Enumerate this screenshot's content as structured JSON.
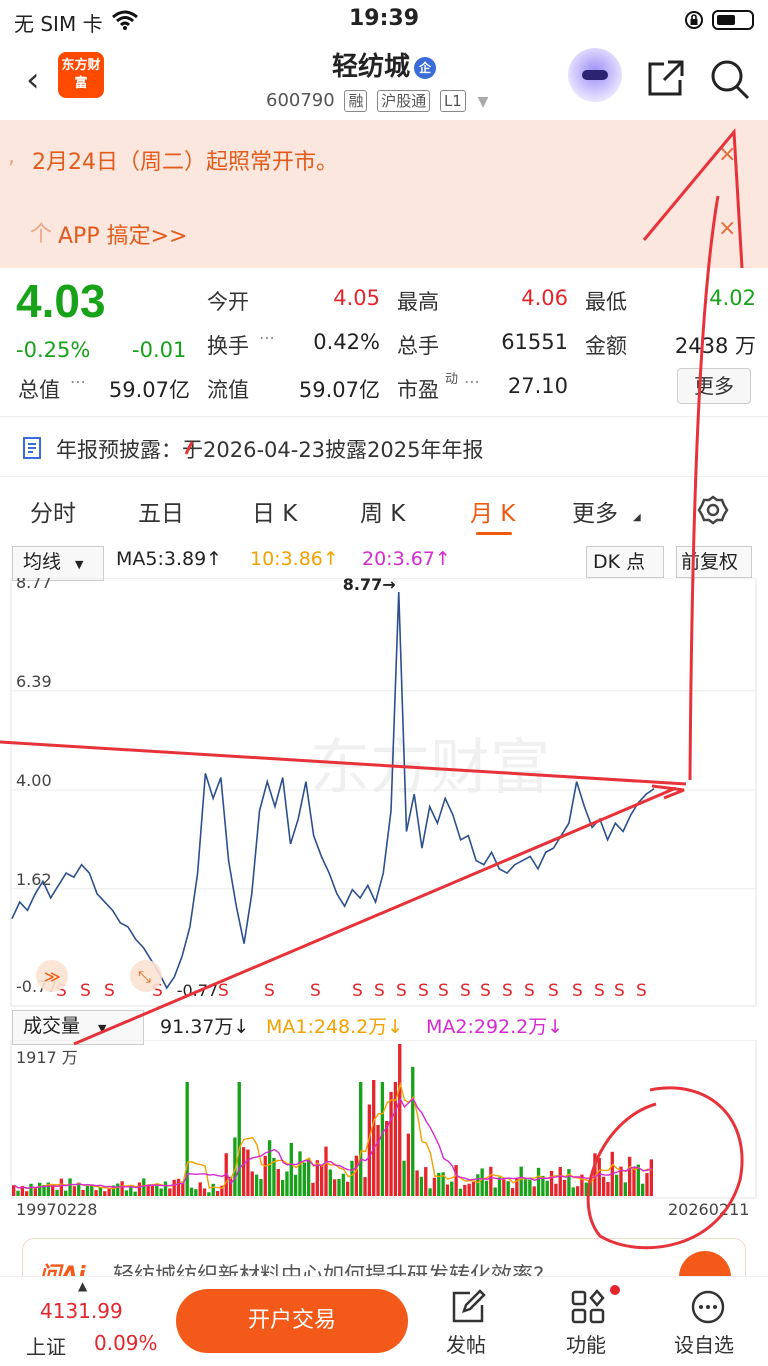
{
  "status_bar": {
    "carrier": "无 SIM 卡",
    "time": "19:39"
  },
  "header": {
    "logo_text": "东方财富",
    "name": "轻纺城",
    "name_badge": "企",
    "code": "600790",
    "tags": [
      "融",
      "沪股通",
      "L1"
    ]
  },
  "notice": {
    "line1": "2月24日（周二）起照常开市。",
    "line2": "APP 搞定>>",
    "close": "×"
  },
  "quote": {
    "price": "4.03",
    "change_pct": "-0.25%",
    "change": "-0.01",
    "fields": [
      {
        "label": "今开",
        "value": "4.05"
      },
      {
        "label": "最高",
        "value": "4.06"
      },
      {
        "label": "最低",
        "value": "4.02"
      },
      {
        "label": "换手",
        "value": "0.42%"
      },
      {
        "label": "总手",
        "value": "61551"
      },
      {
        "label": "金额",
        "value": "2438 万"
      },
      {
        "label": "总值",
        "value": "59.07亿"
      },
      {
        "label": "流值",
        "value": "59.07亿"
      },
      {
        "label": "市盈",
        "value": "27.10"
      }
    ],
    "more_btn": "更多"
  },
  "report": {
    "text": "年报预披露：于2026-04-23披露2025年年报"
  },
  "tabs": [
    {
      "label": "分时"
    },
    {
      "label": "五日"
    },
    {
      "label": "日 K"
    },
    {
      "label": "周 K"
    },
    {
      "label": "月 K"
    },
    {
      "label": "更多"
    }
  ],
  "chart_toolbar": {
    "ma_select": "均线",
    "ma5": "MA5:3.89↑",
    "ma10": "10:3.86↑",
    "ma20": "20:3.67↑",
    "dk_btn": "DK 点",
    "fq_btn": "前复权"
  },
  "chart_data": {
    "type": "line",
    "price_ticks": [
      "8.77",
      "6.39",
      "4.00",
      "1.62",
      "-0.77"
    ],
    "high_marker": "8.77→",
    "low_marker": "-0.77",
    "series": [
      {
        "values": [
          0.9,
          1.3,
          1.1,
          1.5,
          1.8,
          1.4,
          1.7,
          2.0,
          1.9,
          2.2,
          2.0,
          1.5,
          1.3,
          1.1,
          0.8,
          0.7,
          0.4,
          0.2,
          -0.1,
          -0.4,
          -0.77,
          -0.5,
          0.0,
          0.7,
          2.0,
          4.4,
          3.8,
          4.3,
          2.3,
          1.2,
          0.3,
          1.5,
          3.5,
          4.2,
          3.6,
          4.3,
          2.7,
          3.3,
          4.2,
          2.9,
          2.4,
          2.0,
          1.5,
          1.2,
          1.6,
          1.4,
          1.7,
          1.3,
          2.0,
          3.5,
          8.77,
          3.0,
          3.9,
          2.6,
          3.6,
          3.2,
          3.8,
          3.4,
          2.8,
          2.9,
          2.3,
          2.2,
          2.5,
          2.1,
          2.0,
          2.2,
          2.3,
          2.4,
          2.1,
          2.5,
          2.6,
          2.9,
          3.2,
          4.2,
          3.6,
          3.1,
          3.3,
          2.8,
          3.2,
          3.0,
          3.4,
          3.7,
          3.9,
          4.03
        ]
      }
    ],
    "signals": [
      "S",
      "S",
      "S",
      "S",
      "S",
      "S",
      "S",
      "S",
      "S",
      "S",
      "S",
      "S",
      "S",
      "S",
      "S",
      "S",
      "S",
      "S",
      "S",
      "S",
      "S",
      "S",
      "S"
    ],
    "volume_label": "成交量",
    "volume_now": "91.37万↓",
    "vol_ma1": "MA1:248.2万↓",
    "vol_ma2": "MA2:292.2万↓",
    "volume_max": "1917 万",
    "x_start": "19970228",
    "x_end": "20260211",
    "colors": {
      "line": "#2c4f8e",
      "up": "#e4262c",
      "down": "#17a21a",
      "ma1": "#f2a100",
      "ma2": "#d52ad0"
    }
  },
  "ai_banner": {
    "text": "轻纺城纺织新材料中心如何提升研发转化效率?"
  },
  "bottom_bar": {
    "index_value": "4131.99",
    "index_name": "上证",
    "index_pct": "0.09%",
    "trade_btn": "开户交易",
    "post": "发帖",
    "func": "功能",
    "watch": "设自选"
  }
}
